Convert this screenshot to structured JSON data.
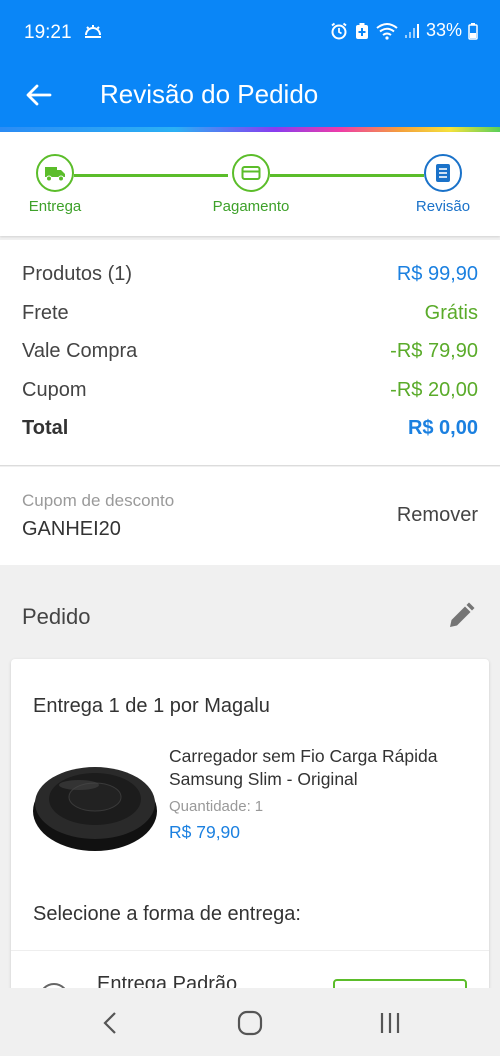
{
  "status_bar": {
    "time": "19:21",
    "battery": "33%",
    "icons": [
      "weather-icon",
      "alarm-icon",
      "battery-saver-icon",
      "wifi-icon",
      "signal-icon",
      "battery-icon"
    ]
  },
  "header": {
    "title": "Revisão do Pedido",
    "back_icon": "arrow-left-icon",
    "background": "#0a86f7"
  },
  "steps": [
    {
      "label": "Entrega",
      "icon": "truck-icon",
      "state": "done",
      "color": "#5bbd2a"
    },
    {
      "label": "Pagamento",
      "icon": "card-icon",
      "state": "done",
      "color": "#5bbd2a"
    },
    {
      "label": "Revisão",
      "icon": "list-icon",
      "state": "current",
      "color": "#1a72c9"
    }
  ],
  "summary": {
    "rows": [
      {
        "label": "Produtos (1)",
        "value": "R$ 99,90",
        "color": "blue"
      },
      {
        "label": "Frete",
        "value": "Grátis",
        "color": "green"
      },
      {
        "label": "Vale Compra",
        "value": "-R$ 79,90",
        "color": "green"
      },
      {
        "label": "Cupom",
        "value": "-R$ 20,00",
        "color": "green"
      },
      {
        "label": "Total",
        "value": "R$ 0,00",
        "color": "blue"
      }
    ]
  },
  "coupon": {
    "label": "Cupom de desconto",
    "code": "GANHEI20",
    "remove_label": "Remover"
  },
  "order": {
    "title": "Pedido",
    "edit_icon": "pencil-icon",
    "delivery_title": "Entrega 1 de 1 por Magalu",
    "product": {
      "name": "Carregador sem Fio Carga Rápida Samsung Slim - Original",
      "quantity_label": "Quantidade:",
      "quantity": "1",
      "price": "R$ 79,90"
    },
    "select_delivery": "Selecione a forma de entrega:",
    "delivery_option": "Entrega Padrão"
  },
  "nav": {
    "back": "nav-back-icon",
    "home": "nav-home-icon",
    "recents": "nav-recents-icon"
  }
}
